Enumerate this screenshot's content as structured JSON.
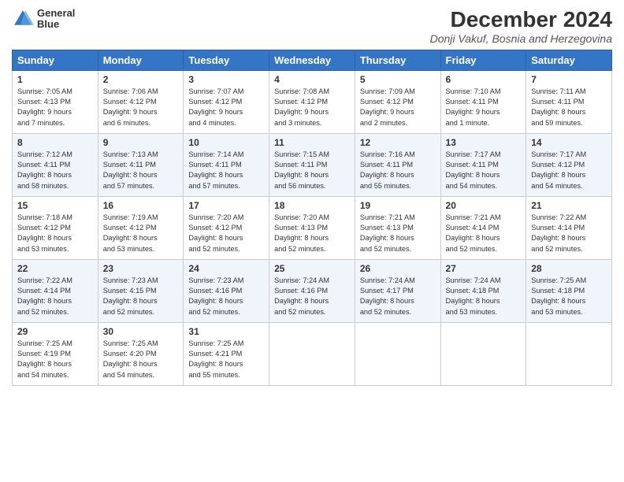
{
  "header": {
    "logo_line1": "General",
    "logo_line2": "Blue",
    "title": "December 2024",
    "subtitle": "Donji Vakuf, Bosnia and Herzegovina"
  },
  "weekdays": [
    "Sunday",
    "Monday",
    "Tuesday",
    "Wednesday",
    "Thursday",
    "Friday",
    "Saturday"
  ],
  "weeks": [
    [
      {
        "day": 1,
        "info": "Sunrise: 7:05 AM\nSunset: 4:13 PM\nDaylight: 9 hours\nand 7 minutes."
      },
      {
        "day": 2,
        "info": "Sunrise: 7:06 AM\nSunset: 4:12 PM\nDaylight: 9 hours\nand 6 minutes."
      },
      {
        "day": 3,
        "info": "Sunrise: 7:07 AM\nSunset: 4:12 PM\nDaylight: 9 hours\nand 4 minutes."
      },
      {
        "day": 4,
        "info": "Sunrise: 7:08 AM\nSunset: 4:12 PM\nDaylight: 9 hours\nand 3 minutes."
      },
      {
        "day": 5,
        "info": "Sunrise: 7:09 AM\nSunset: 4:12 PM\nDaylight: 9 hours\nand 2 minutes."
      },
      {
        "day": 6,
        "info": "Sunrise: 7:10 AM\nSunset: 4:11 PM\nDaylight: 9 hours\nand 1 minute."
      },
      {
        "day": 7,
        "info": "Sunrise: 7:11 AM\nSunset: 4:11 PM\nDaylight: 8 hours\nand 59 minutes."
      }
    ],
    [
      {
        "day": 8,
        "info": "Sunrise: 7:12 AM\nSunset: 4:11 PM\nDaylight: 8 hours\nand 58 minutes."
      },
      {
        "day": 9,
        "info": "Sunrise: 7:13 AM\nSunset: 4:11 PM\nDaylight: 8 hours\nand 57 minutes."
      },
      {
        "day": 10,
        "info": "Sunrise: 7:14 AM\nSunset: 4:11 PM\nDaylight: 8 hours\nand 57 minutes."
      },
      {
        "day": 11,
        "info": "Sunrise: 7:15 AM\nSunset: 4:11 PM\nDaylight: 8 hours\nand 56 minutes."
      },
      {
        "day": 12,
        "info": "Sunrise: 7:16 AM\nSunset: 4:11 PM\nDaylight: 8 hours\nand 55 minutes."
      },
      {
        "day": 13,
        "info": "Sunrise: 7:17 AM\nSunset: 4:11 PM\nDaylight: 8 hours\nand 54 minutes."
      },
      {
        "day": 14,
        "info": "Sunrise: 7:17 AM\nSunset: 4:12 PM\nDaylight: 8 hours\nand 54 minutes."
      }
    ],
    [
      {
        "day": 15,
        "info": "Sunrise: 7:18 AM\nSunset: 4:12 PM\nDaylight: 8 hours\nand 53 minutes."
      },
      {
        "day": 16,
        "info": "Sunrise: 7:19 AM\nSunset: 4:12 PM\nDaylight: 8 hours\nand 53 minutes."
      },
      {
        "day": 17,
        "info": "Sunrise: 7:20 AM\nSunset: 4:12 PM\nDaylight: 8 hours\nand 52 minutes."
      },
      {
        "day": 18,
        "info": "Sunrise: 7:20 AM\nSunset: 4:13 PM\nDaylight: 8 hours\nand 52 minutes."
      },
      {
        "day": 19,
        "info": "Sunrise: 7:21 AM\nSunset: 4:13 PM\nDaylight: 8 hours\nand 52 minutes."
      },
      {
        "day": 20,
        "info": "Sunrise: 7:21 AM\nSunset: 4:14 PM\nDaylight: 8 hours\nand 52 minutes."
      },
      {
        "day": 21,
        "info": "Sunrise: 7:22 AM\nSunset: 4:14 PM\nDaylight: 8 hours\nand 52 minutes."
      }
    ],
    [
      {
        "day": 22,
        "info": "Sunrise: 7:22 AM\nSunset: 4:14 PM\nDaylight: 8 hours\nand 52 minutes."
      },
      {
        "day": 23,
        "info": "Sunrise: 7:23 AM\nSunset: 4:15 PM\nDaylight: 8 hours\nand 52 minutes."
      },
      {
        "day": 24,
        "info": "Sunrise: 7:23 AM\nSunset: 4:16 PM\nDaylight: 8 hours\nand 52 minutes."
      },
      {
        "day": 25,
        "info": "Sunrise: 7:24 AM\nSunset: 4:16 PM\nDaylight: 8 hours\nand 52 minutes."
      },
      {
        "day": 26,
        "info": "Sunrise: 7:24 AM\nSunset: 4:17 PM\nDaylight: 8 hours\nand 52 minutes."
      },
      {
        "day": 27,
        "info": "Sunrise: 7:24 AM\nSunset: 4:18 PM\nDaylight: 8 hours\nand 53 minutes."
      },
      {
        "day": 28,
        "info": "Sunrise: 7:25 AM\nSunset: 4:18 PM\nDaylight: 8 hours\nand 53 minutes."
      }
    ],
    [
      {
        "day": 29,
        "info": "Sunrise: 7:25 AM\nSunset: 4:19 PM\nDaylight: 8 hours\nand 54 minutes."
      },
      {
        "day": 30,
        "info": "Sunrise: 7:25 AM\nSunset: 4:20 PM\nDaylight: 8 hours\nand 54 minutes."
      },
      {
        "day": 31,
        "info": "Sunrise: 7:25 AM\nSunset: 4:21 PM\nDaylight: 8 hours\nand 55 minutes."
      },
      null,
      null,
      null,
      null
    ]
  ]
}
